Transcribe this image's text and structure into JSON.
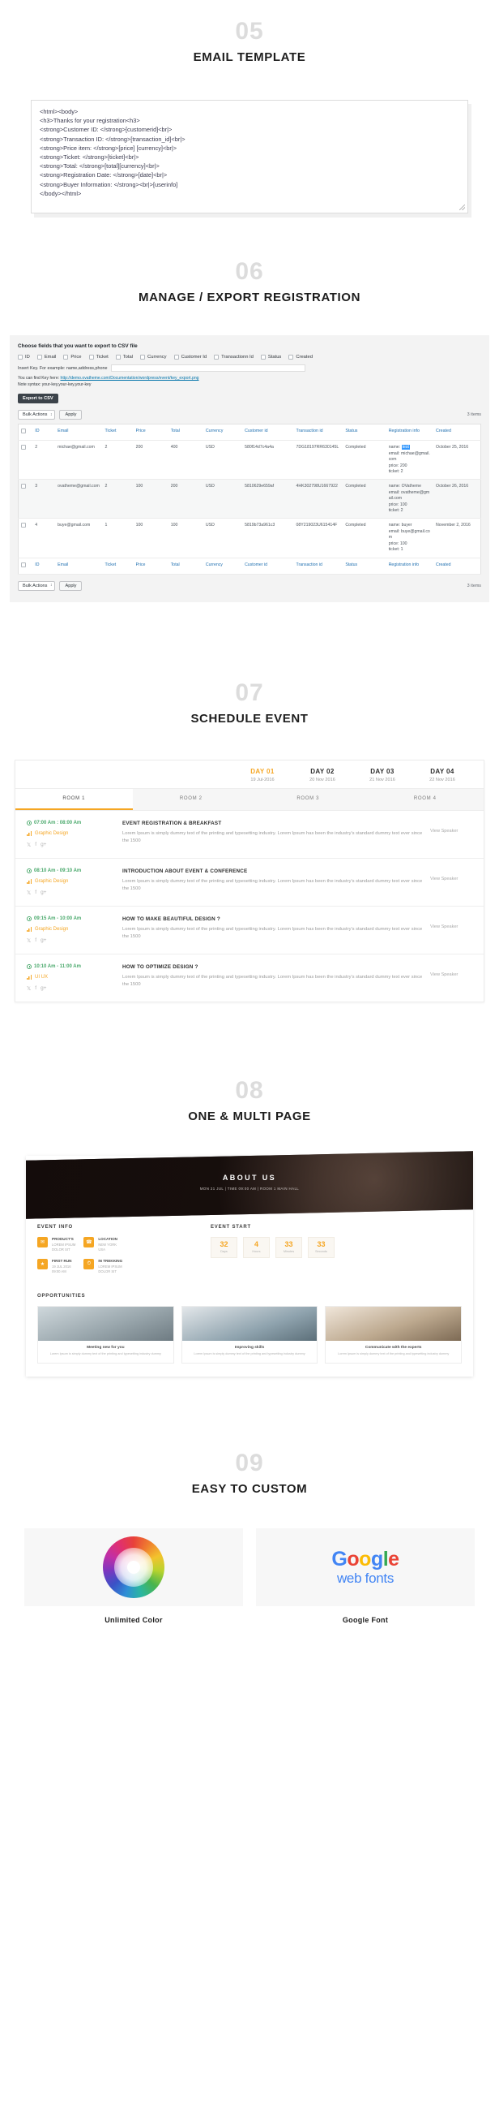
{
  "sections": {
    "email_template": {
      "number": "05",
      "title": "EMAIL TEMPLATE",
      "code_lines": [
        "<html><body>",
        "<h3>Thanks for your registration<h3>",
        "<strong>Customer ID: </strong>[customerid]<br|>",
        "<strong>Transaction ID: </strong>[transaction_id]<br|>",
        "<strong>Price item: </strong>[price] [currency]<br|>",
        "<strong>Ticket: </strong>[ticket]<br|>",
        "<strong>Total: </strong>[total][currency]<br|>",
        "<strong>Registration Date: </strong>[date]<br|>",
        "<strong>Buyer Information: </strong><br|>[userinfo]",
        "</body></html>"
      ]
    },
    "manage_export": {
      "number": "06",
      "title": "MANAGE / EXPORT REGISTRATION",
      "panel_title": "Choose fields that you want to export to CSV file",
      "checkboxes": [
        "ID",
        "Email",
        "Price",
        "Ticket",
        "Total",
        "Currency",
        "Customer Id",
        "Transactionn Id",
        "Status",
        "Created"
      ],
      "key_hint": "Insert Key. For example: name,address,phone",
      "key_value": "",
      "find_key_prefix": "You can find Key here: ",
      "find_key_link": "http://demo.ovatheme.com/Documentation/wordpress/event/key_export.png",
      "note_syntax": "Note syntax: your-key,your-key,your-key",
      "export_button": "Export to CSV",
      "bulk_actions_label": "Bulk Actions",
      "apply_label": "Apply",
      "items_count": "3 items",
      "columns": [
        "ID",
        "Email",
        "Ticket",
        "Price",
        "Total",
        "Currency",
        "Customer id",
        "Transaction id",
        "Status",
        "Registration info",
        "Created"
      ],
      "rows": [
        {
          "id": "2",
          "email": "michae@gmail.com",
          "ticket": "2",
          "price": "200",
          "total": "400",
          "currency": "USD",
          "customer_id": "580f14d7c4a4a",
          "transaction_id": "7DG18197RR630145L",
          "status": "Completed",
          "reg_name_label": "name:",
          "reg_name_value": "test",
          "reg_info_rest": "email: michae@gmail.com\nprice: 200\nticket: 2",
          "created": "October 25, 2016"
        },
        {
          "id": "3",
          "email": "ovatheme@gmail.com",
          "ticket": "2",
          "price": "100",
          "total": "200",
          "currency": "USD",
          "customer_id": "5810629e659af",
          "transaction_id": "4HK302798U1667922",
          "status": "Completed",
          "reg_name_label": "name:",
          "reg_name_value": "OVatheme",
          "reg_info_rest": "email: ovatheme@gmail.com\nprice: 100\nticket: 2",
          "created": "October 26, 2016"
        },
        {
          "id": "4",
          "email": "buye@gmail.com",
          "ticket": "1",
          "price": "100",
          "total": "100",
          "currency": "USD",
          "customer_id": "5819b73a961c3",
          "transaction_id": "08Y219023U615414F",
          "status": "Completed",
          "reg_name_label": "name:",
          "reg_name_value": "buyer",
          "reg_info_rest": "email: buye@gmail.com\nprice: 100\nticket: 1",
          "created": "November 2, 2016"
        }
      ]
    },
    "schedule": {
      "number": "07",
      "title": "SCHEDULE EVENT",
      "days": [
        {
          "name": "DAY 01",
          "date": "19 Jul-2016",
          "active": true
        },
        {
          "name": "DAY 02",
          "date": "20 Nov 2016",
          "active": false
        },
        {
          "name": "DAY 03",
          "date": "21 Nov 2016",
          "active": false
        },
        {
          "name": "DAY 04",
          "date": "22 Nov 2016",
          "active": false
        }
      ],
      "rooms": [
        "ROOM 1",
        "ROOM 2",
        "ROOM 3",
        "ROOM 4"
      ],
      "view_speaker": "View Speaker",
      "items": [
        {
          "time": "07:00 Am : 08:00 Am",
          "category": "Graphic Design",
          "title": "EVENT REGISTRATION & BREAKFAST",
          "desc": "Lorem Ipsum is simply dummy text of the printing and typesetting industry. Lorem Ipsum has been the industry's standard dummy text ever since the 1500"
        },
        {
          "time": "08:10 Am - 09:10 Am",
          "category": "Graphic Design",
          "title": "INTRODUCTION ABOUT EVENT & CONFERENCE",
          "desc": "Lorem Ipsum is simply dummy text of the printing and typesetting industry. Lorem Ipsum has been the industry's standard dummy text ever since the 1500"
        },
        {
          "time": "09:15 Am - 10:00 Am",
          "category": "Graphic Design",
          "title": "HOW TO MAKE BEAUTIFUL DESIGN ?",
          "desc": "Lorem Ipsum is simply dummy text of the printing and typesetting industry. Lorem Ipsum has been the industry's standard dummy text ever since the 1500"
        },
        {
          "time": "10:10 Am - 11:00 Am",
          "category": "UI UX",
          "title": "HOW TO OPTIMIZE DESIGN ?",
          "desc": "Lorem Ipsum is simply dummy text of the printing and typesetting industry. Lorem Ipsum has been the industry's standard dummy text ever since the 1500"
        }
      ]
    },
    "onepage": {
      "number": "08",
      "title": "ONE & MULTI PAGE",
      "hero_title": "ABOUT US",
      "hero_sub": "MON 21 JUL | TIME 09:00 AM | ROOM 1 MAIN HALL",
      "event_info_title": "EVENT INFO",
      "event_start_title": "EVENT START",
      "opportunities_title": "OPPORTUNITIES",
      "info_items": [
        {
          "icon": "✉",
          "label": "PRODUCT'S",
          "value": "LOREM IPSUM\nDOLOR SIT"
        },
        {
          "icon": "☎",
          "label": "LOCATION",
          "value": "NEW YORK\nUSA"
        },
        {
          "icon": "★",
          "label": "FIRST RUN",
          "value": "19 JUL 2016\n09:00 AM"
        },
        {
          "icon": "⏱",
          "label": "IN TREKKING",
          "value": "LOREM IPSUM\nDOLOR SIT"
        }
      ],
      "countdown": [
        {
          "num": "32",
          "label": "Days"
        },
        {
          "num": "4",
          "label": "Hours"
        },
        {
          "num": "33",
          "label": "Minutes"
        },
        {
          "num": "33",
          "label": "Seconds"
        }
      ],
      "opportunities": [
        {
          "title": "Meeting new for you",
          "desc": "Lorem Ipsum is simply dummy text of the printing and typesetting industry dummy"
        },
        {
          "title": "Improving skills",
          "desc": "Lorem Ipsum is simply dummy text of the printing and typesetting industry dummy"
        },
        {
          "title": "Communicate with the experts",
          "desc": "Lorem Ipsum is simply dummy text of the printing and typesetting industry dummy"
        }
      ]
    },
    "custom": {
      "number": "09",
      "title": "EASY TO CUSTOM",
      "color_caption": "Unlimited Color",
      "font_caption": "Google Font",
      "google_word": [
        "G",
        "o",
        "o",
        "g",
        "l",
        "e"
      ],
      "google_sub": "web fonts"
    }
  }
}
